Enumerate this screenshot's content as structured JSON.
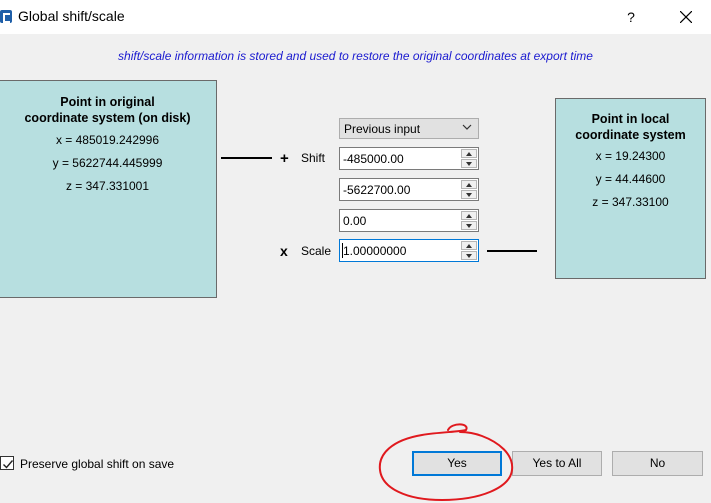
{
  "window": {
    "title": "Global shift/scale",
    "help_label": "?",
    "app_icon": "cloudcompare-icon",
    "close_icon": "close-icon"
  },
  "info_text": "shift/scale information is stored and used to restore the original coordinates at export time",
  "original": {
    "heading_line1": "Point in original",
    "heading_line2": "coordinate system (on disk)",
    "x": "x = 485019.242996",
    "y": "y = 5622744.445999",
    "z": "z = 347.331001"
  },
  "local": {
    "heading_line1": "Point in local",
    "heading_line2": "coordinate system",
    "x": "x = 19.24300",
    "y": "y = 44.44600",
    "z": "z = 347.33100"
  },
  "transform": {
    "plus_symbol": "+",
    "shift_label": "Shift",
    "times_symbol": "x",
    "scale_label": "Scale",
    "preset_selected": "Previous input",
    "shift_x": "-485000.00",
    "shift_y": "-5622700.00",
    "shift_z": "0.00",
    "scale": "1.00000000"
  },
  "preserve": {
    "label": "Preserve global shift on save",
    "checked": true
  },
  "buttons": {
    "yes": "Yes",
    "yes_to_all": "Yes to All",
    "no": "No"
  },
  "colors": {
    "info_text": "#1a1ad0",
    "coord_box": "#b7dfe0",
    "annotation": "#e0191e",
    "focus": "#0078d7"
  }
}
